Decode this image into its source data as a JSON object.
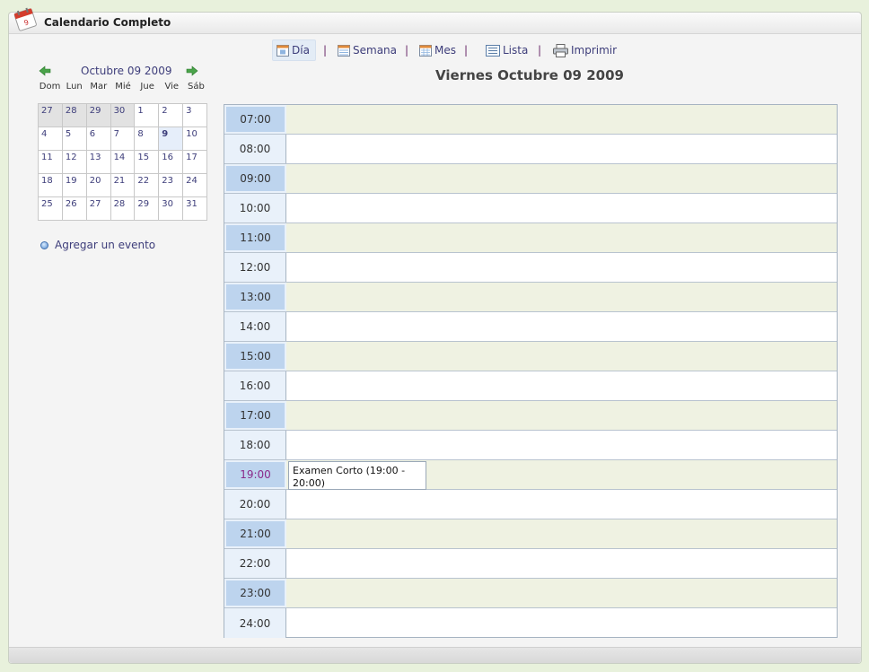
{
  "app": {
    "title": "Calendario Completo"
  },
  "toolbar": {
    "items": [
      {
        "label": "Día",
        "icon": "day-view-icon",
        "active": true
      },
      {
        "label": "Semana",
        "icon": "week-view-icon"
      },
      {
        "label": "Mes",
        "icon": "month-view-icon"
      },
      {
        "label": "Lista",
        "icon": "list-view-icon"
      },
      {
        "label": "Imprimir",
        "icon": "printer-icon"
      }
    ],
    "separator": "|"
  },
  "mini_calendar": {
    "title": "Octubre 09 2009",
    "dows": [
      "Dom",
      "Lun",
      "Mar",
      "Mié",
      "Jue",
      "Vie",
      "Sáb"
    ],
    "weeks": [
      [
        "27",
        "28",
        "29",
        "30",
        "1",
        "2",
        "3"
      ],
      [
        "4",
        "5",
        "6",
        "7",
        "8",
        "9",
        "10"
      ],
      [
        "11",
        "12",
        "13",
        "14",
        "15",
        "16",
        "17"
      ],
      [
        "18",
        "19",
        "20",
        "21",
        "22",
        "23",
        "24"
      ],
      [
        "25",
        "26",
        "27",
        "28",
        "29",
        "30",
        "31"
      ]
    ],
    "selected_day": "9"
  },
  "sidebar": {
    "add_event_label": "Agregar un evento"
  },
  "day_view": {
    "title": "Viernes Octubre 09 2009",
    "hours": [
      "07:00",
      "08:00",
      "09:00",
      "10:00",
      "11:00",
      "12:00",
      "13:00",
      "14:00",
      "15:00",
      "16:00",
      "17:00",
      "18:00",
      "19:00",
      "20:00",
      "21:00",
      "22:00",
      "23:00",
      "24:00"
    ],
    "highlighted_hour": "19:00",
    "events": [
      {
        "hour": "19:00",
        "label": "Examen Corto (19:00 - 20:00)"
      }
    ]
  },
  "colors": {
    "link": "#3d3d7a",
    "hour_highlight": "#8a2a8a",
    "alt_row": "#eff2e2",
    "hour_label_dark": "#bdd4ee"
  }
}
